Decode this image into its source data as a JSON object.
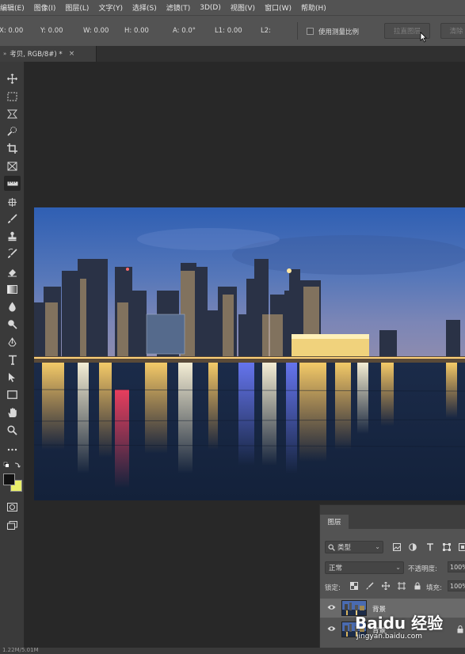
{
  "menubar": {
    "items": [
      "编辑(E)",
      "图像(I)",
      "图层(L)",
      "文字(Y)",
      "选择(S)",
      "滤镜(T)",
      "3D(D)",
      "视图(V)",
      "窗口(W)",
      "帮助(H)"
    ]
  },
  "options": {
    "x": "X: 0.00",
    "y": "Y: 0.00",
    "w": "W: 0.00",
    "h": "H: 0.00",
    "a": "A: 0.0°",
    "l1": "L1: 0.00",
    "l2": "L2:",
    "use_scale": "使用测量比例",
    "straighten_button": "拉直图层",
    "clear_button": "清除"
  },
  "tab": {
    "title": "考贝, RGB/8#) *",
    "close": "×",
    "arrows": "»"
  },
  "layers_panel": {
    "tab_label": "图层",
    "filter_kind": "类型",
    "blend_mode": "正常",
    "opacity_label": "不透明度:",
    "opacity_value": "100%",
    "lock_label": "锁定:",
    "fill_label": "填充:",
    "fill_value": "100%",
    "layers": [
      {
        "name": "背景",
        "selected": true,
        "locked": false
      },
      {
        "name": "背景",
        "selected": false,
        "locked": true
      }
    ]
  },
  "status": {
    "doc_size": "1.22M/5.01M"
  },
  "watermark": {
    "logo": "Baidu 经验",
    "url": "jingyan.baidu.com"
  },
  "colors": {
    "menubar": "#535353",
    "panel": "#535353",
    "canvas_bg": "#282828",
    "toolbar": "#3a3a3a",
    "foreground": "#111111",
    "background": "#e9ef6a"
  }
}
